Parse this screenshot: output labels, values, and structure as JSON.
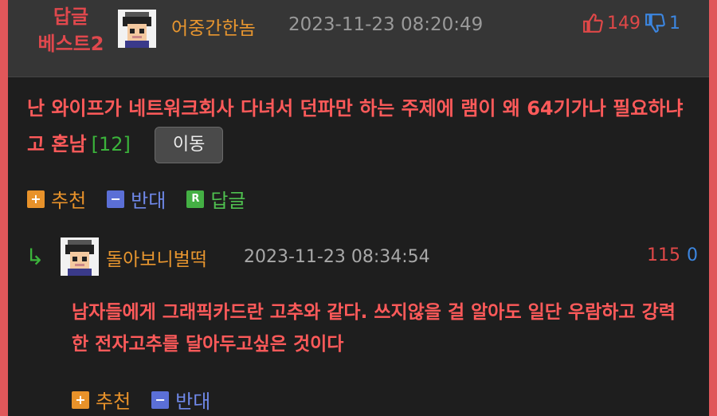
{
  "best": {
    "line1": "답글",
    "line2": "베스트2"
  },
  "post": {
    "nickname": "어중간한놈",
    "date": "2023-11-23 08:20:49",
    "likes": "149",
    "dislikes": "1",
    "text": "난 와이프가 네트워크회사 다녀서 던파만 하는 주제에 램이 왜 64기가나 필요하냐고 혼남",
    "comment_count": "[12]",
    "move_label": "이동",
    "actions": {
      "recommend": "추천",
      "oppose": "반대",
      "reply": "답글"
    }
  },
  "reply": {
    "nickname": "돌아보니벌떡",
    "date": "2023-11-23 08:34:54",
    "likes": "115",
    "dislikes": "0",
    "text": "남자들에게 그래픽카드란 고추와 같다. 쓰지않을 걸 알아도 일단 우람하고 강력한 전자고추를 달아두고싶은 것이다",
    "actions": {
      "recommend": "추천",
      "oppose": "반대"
    }
  },
  "icons": {
    "plus": "+",
    "minus": "−",
    "reply": "R",
    "reply_arrow": "↳"
  },
  "colors": {
    "frame": "#e0575a",
    "accent_red": "#ff5a5a",
    "nick_orange": "#e8962f",
    "count_green": "#3bb33b"
  }
}
